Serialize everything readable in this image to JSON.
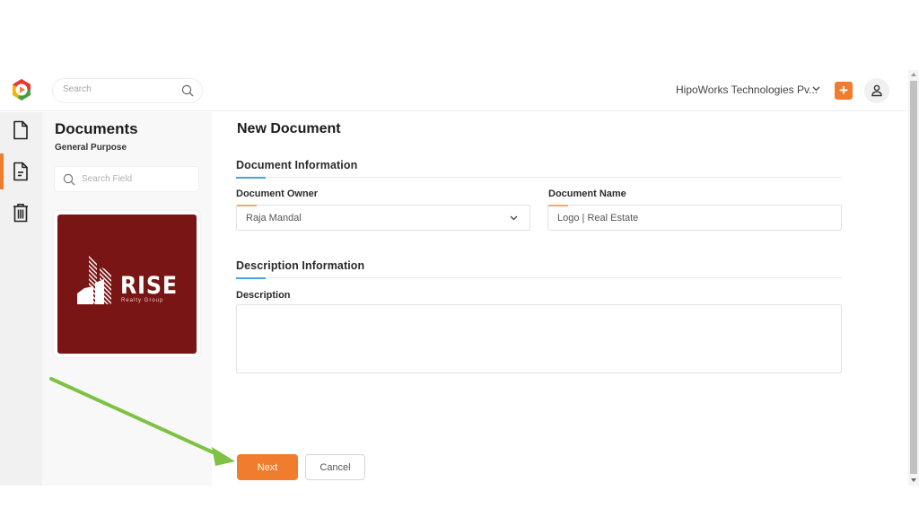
{
  "topbar": {
    "search_placeholder": "Search",
    "company_name": "HipoWorks Technologies Pv...",
    "add_label": "+",
    "icons": {
      "logo": "app-logo-hexagon-play",
      "search": "search-icon",
      "company_dropdown": "chevron-down-icon",
      "add": "plus-icon",
      "user": "user-icon"
    }
  },
  "rail": {
    "items": [
      {
        "icon": "file-icon",
        "active": false
      },
      {
        "icon": "document-text-icon",
        "active": true
      },
      {
        "icon": "trash-icon",
        "active": false
      }
    ]
  },
  "panel": {
    "title": "Documents",
    "subtitle": "General Purpose",
    "search_placeholder": "Search Field",
    "card": {
      "brand": "RISE",
      "tagline": "Realty Group",
      "background": "#7a1515"
    }
  },
  "main": {
    "page_title": "New Document",
    "sections": [
      {
        "title": "Document Information"
      },
      {
        "title": "Description Information"
      }
    ],
    "fields": {
      "owner": {
        "label": "Document Owner",
        "value": "Raja Mandal"
      },
      "name": {
        "label": "Document Name",
        "value": "Logo | Real Estate"
      },
      "description": {
        "label": "Description",
        "value": ""
      }
    },
    "buttons": {
      "next": "Next",
      "cancel": "Cancel"
    }
  },
  "colors": {
    "accent": "#ef7d2d",
    "section_underline": "#4aa3df",
    "annotation_arrow": "#7dc242"
  }
}
